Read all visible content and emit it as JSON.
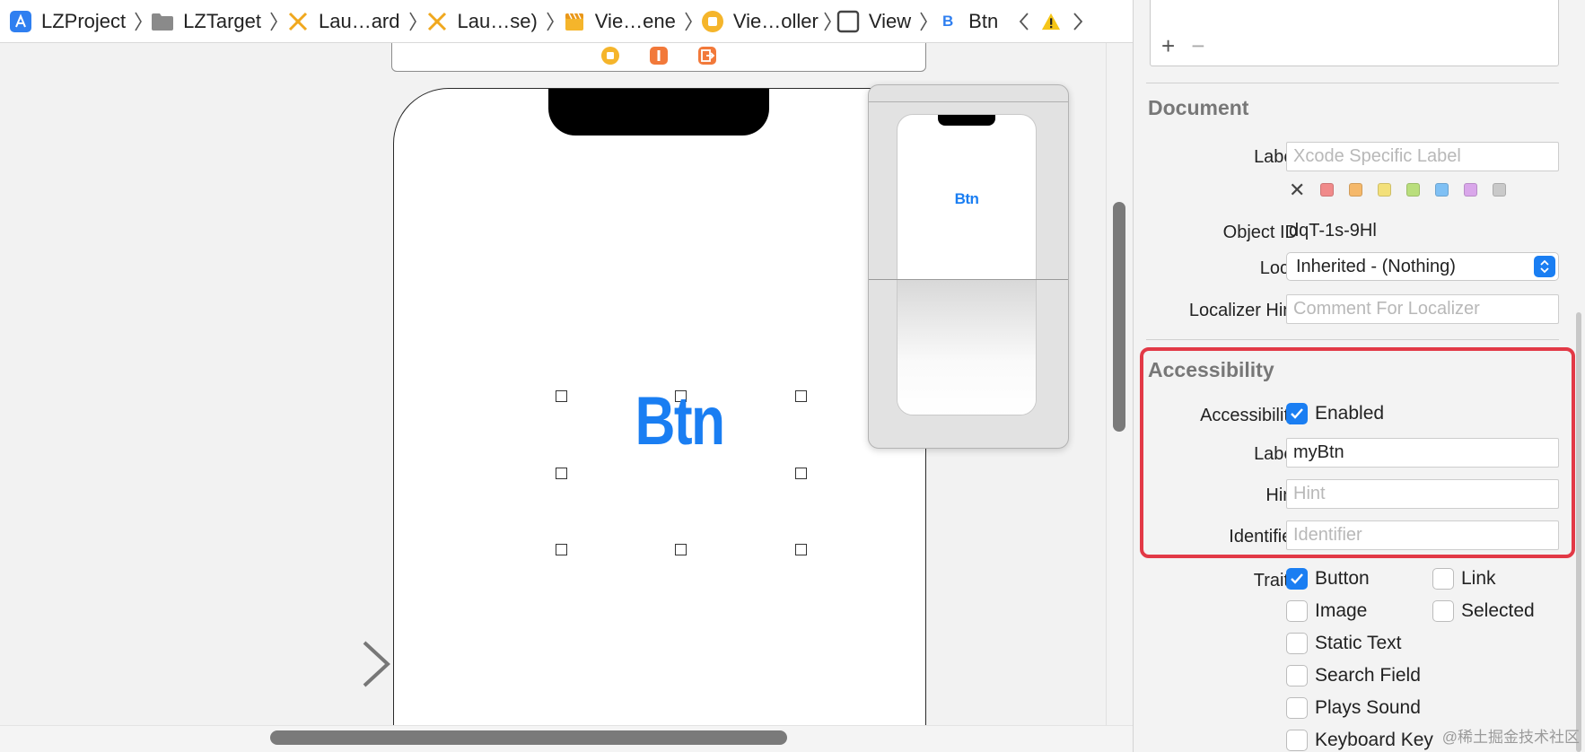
{
  "jumpbar": {
    "crumbs": [
      {
        "label": "LZProject",
        "icon": "app-icon"
      },
      {
        "label": "LZTarget",
        "icon": "folder-icon"
      },
      {
        "label": "Lau…ard",
        "icon": "storyboard-icon"
      },
      {
        "label": "Lau…se)",
        "icon": "storyboard-icon"
      },
      {
        "label": "Vie…ene",
        "icon": "scene-icon"
      },
      {
        "label": "Vie…oller",
        "icon": "view-controller-icon"
      },
      {
        "label": "View",
        "icon": "view-icon"
      },
      {
        "label": "Btn",
        "icon": "button-icon",
        "glyph": "B"
      }
    ]
  },
  "canvas": {
    "button_title": "Btn",
    "preview_button_title": "Btn"
  },
  "inspector": {
    "document": {
      "title": "Document",
      "label_label": "Label",
      "label_placeholder": "Xcode Specific Label",
      "object_id_label": "Object ID",
      "object_id_value": "dqT-1s-9Hl",
      "lock_label": "Lock",
      "lock_value": "Inherited - (Nothing)",
      "localizer_hint_label": "Localizer Hint",
      "localizer_hint_placeholder": "Comment For Localizer",
      "colors": [
        "#f08a8a",
        "#f5b86a",
        "#f3e07a",
        "#b9de7c",
        "#7fc0f4",
        "#d9a6ea",
        "#c9c9c9"
      ]
    },
    "accessibility": {
      "title": "Accessibility",
      "accessibility_label": "Accessibility",
      "enabled_label": "Enabled",
      "enabled_checked": true,
      "label_label": "Label",
      "label_value": "myBtn",
      "hint_label": "Hint",
      "hint_placeholder": "Hint",
      "identifier_label": "Identifier",
      "identifier_placeholder": "Identifier"
    },
    "traits": {
      "title": "Traits",
      "items": [
        {
          "label": "Button",
          "checked": true
        },
        {
          "label": "Link",
          "checked": false
        },
        {
          "label": "Image",
          "checked": false
        },
        {
          "label": "Selected",
          "checked": false
        },
        {
          "label": "Static Text",
          "checked": false
        },
        {
          "label": "Search Field",
          "checked": false
        },
        {
          "label": "Plays Sound",
          "checked": false
        },
        {
          "label": "Keyboard Key",
          "checked": false
        }
      ]
    },
    "list_tools": {
      "add": "+",
      "remove": "−"
    }
  },
  "watermark": "@稀土掘金技术社区",
  "colors": {
    "accent": "#1a7ef2",
    "highlight": "#e23946",
    "warning": "#f5c518"
  }
}
